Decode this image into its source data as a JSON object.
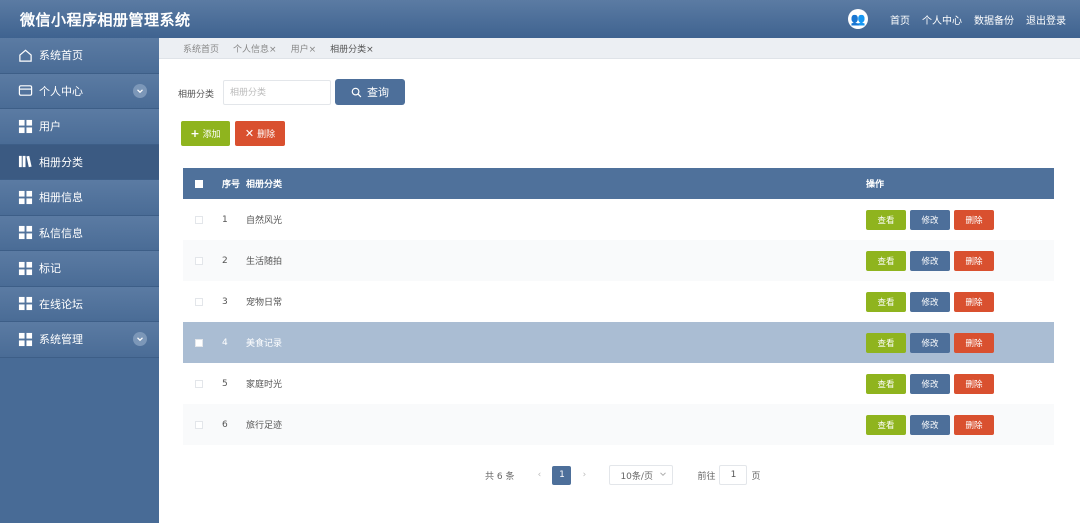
{
  "header": {
    "title": "微信小程序相册管理系统",
    "avatar_glyph": "👥",
    "links": [
      "首页",
      "个人中心",
      "数据备份",
      "退出登录"
    ]
  },
  "sidebar": {
    "items": [
      {
        "label": "系统首页",
        "icon": "home-icon"
      },
      {
        "label": "个人中心",
        "icon": "card-icon",
        "expandable": true
      },
      {
        "label": "用户",
        "icon": "grid-icon"
      },
      {
        "label": "相册分类",
        "icon": "book-icon",
        "active": true
      },
      {
        "label": "相册信息",
        "icon": "grid-icon"
      },
      {
        "label": "私信信息",
        "icon": "grid-icon"
      },
      {
        "label": "标记",
        "icon": "grid-icon"
      },
      {
        "label": "在线论坛",
        "icon": "grid-icon"
      },
      {
        "label": "系统管理",
        "icon": "grid-icon",
        "expandable": true
      }
    ]
  },
  "tabs": [
    "系统首页",
    "个人信息×",
    "用户×",
    "相册分类×"
  ],
  "search": {
    "label": "相册分类",
    "placeholder": "相册分类",
    "value": "",
    "button": "查询"
  },
  "actions": {
    "add": "添加",
    "add_glyph": "+",
    "delete": "删除",
    "delete_glyph": "✕"
  },
  "table": {
    "headers": {
      "index": "序号",
      "name": "相册分类",
      "ops": "操作"
    },
    "rows": [
      {
        "index": "1",
        "name": "自然风光"
      },
      {
        "index": "2",
        "name": "生活随拍"
      },
      {
        "index": "3",
        "name": "宠物日常"
      },
      {
        "index": "4",
        "name": "美食记录"
      },
      {
        "index": "5",
        "name": "家庭时光"
      },
      {
        "index": "6",
        "name": "旅行足迹"
      }
    ],
    "ops": {
      "view": "查看",
      "edit": "修改",
      "remove": "删除"
    }
  },
  "pager": {
    "total": "共 6 条",
    "prev": "‹",
    "next": "›",
    "current": "1",
    "size": "10条/页",
    "goto_prefix": "前往",
    "goto_value": "1",
    "goto_suffix": "页"
  },
  "colors": {
    "brand": "#4d6f9a",
    "success": "#8fb41e",
    "danger": "#d9502f",
    "highlight_row": "#aabdd3"
  }
}
